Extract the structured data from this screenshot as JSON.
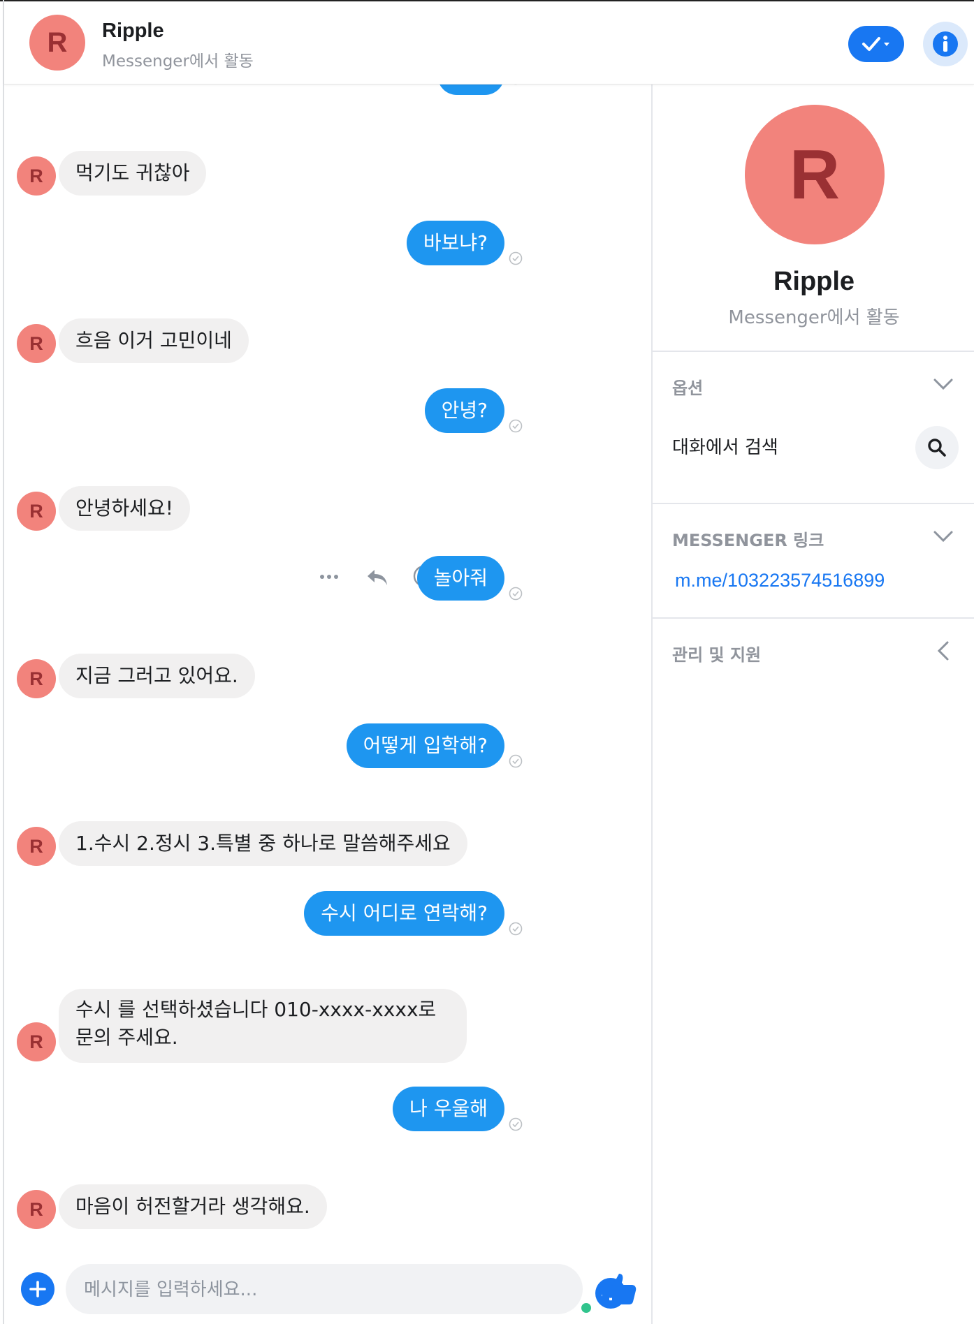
{
  "header": {
    "avatar_letter": "R",
    "title": "Ripple",
    "subtitle": "Messenger에서 활동",
    "check_icon": "checkmark-dropdown-icon",
    "info_icon": "info-icon"
  },
  "messages": [
    {
      "dir": "in",
      "text": "먹기도 귀찮아"
    },
    {
      "dir": "out",
      "text": "바보냐?"
    },
    {
      "dir": "in",
      "text": "흐음 이거 고민이네"
    },
    {
      "dir": "out",
      "text": "안녕?"
    },
    {
      "dir": "in",
      "text": "안녕하세요!"
    },
    {
      "dir": "out",
      "text": "놀아줘"
    },
    {
      "dir": "in",
      "text": "지금 그러고 있어요."
    },
    {
      "dir": "out",
      "text": "어떻게 입학해?"
    },
    {
      "dir": "in",
      "text": "1.수시 2.정시 3.특별 중 하나로 말씀해주세요"
    },
    {
      "dir": "out",
      "text": "수시 어디로 연락해?"
    },
    {
      "dir": "in",
      "text_line1": "수시 를 선택하셨습니다 010-xxxx-xxxx로",
      "text_line2": "문의 주세요."
    },
    {
      "dir": "out",
      "text": "나 우울해"
    },
    {
      "dir": "in",
      "text": "마음이 허전할거라 생각해요."
    }
  ],
  "message_actions": [
    "more-icon",
    "reply-icon",
    "emoji-reaction-icon"
  ],
  "composer": {
    "placeholder": "메시지를 입력하세요...",
    "value": ""
  },
  "panel": {
    "avatar_letter": "R",
    "name": "Ripple",
    "status": "Messenger에서 활동",
    "options_title": "옵션",
    "search_label": "대화에서 검색",
    "messenger_link_title": "MESSENGER 링크",
    "messenger_link": "m.me/103223574516899",
    "manage_title": "관리 및 지원"
  },
  "colors": {
    "accent": "#1877f2",
    "outgoing_bubble": "#1e96f0",
    "incoming_bubble": "#f1f0f0",
    "avatar_bg": "#f2837c",
    "avatar_fg": "#9a3033"
  }
}
